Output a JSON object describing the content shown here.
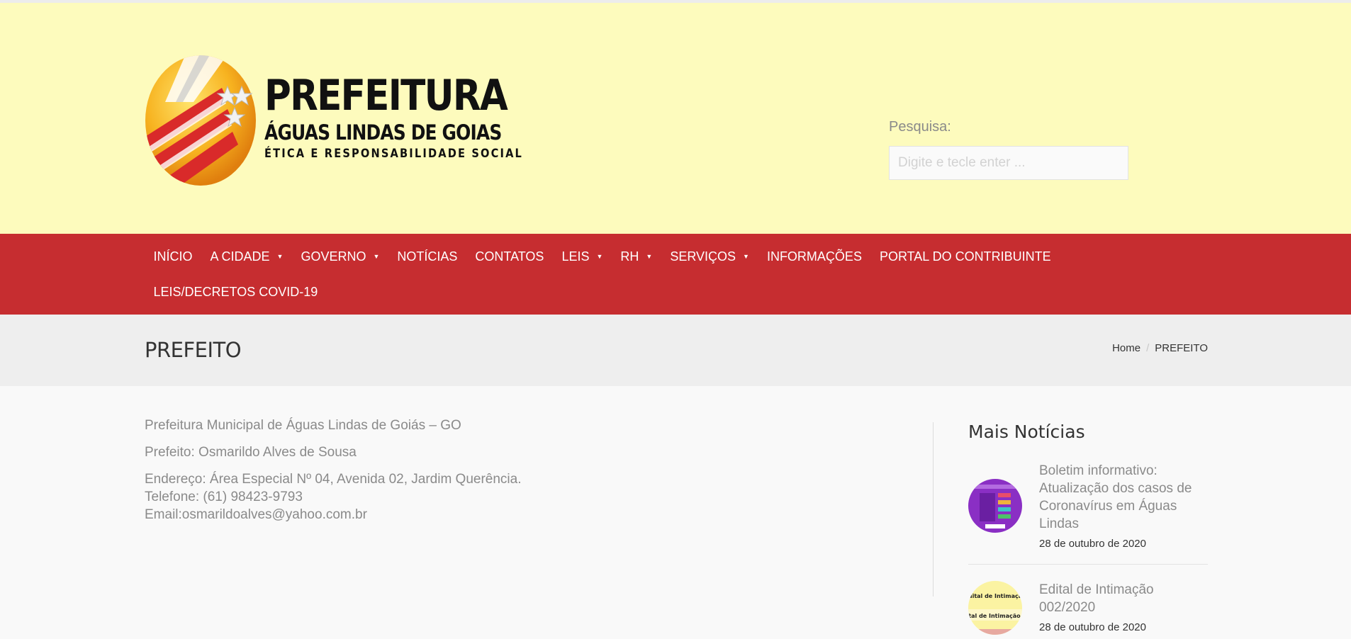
{
  "header": {
    "logo": {
      "line1": "PREFEITURA",
      "line2": "ÁGUAS LINDAS DE GOIAS",
      "line3": "ÉTICA E RESPONSABILIDADE SOCIAL"
    },
    "search": {
      "label": "Pesquisa:",
      "placeholder": "Digite e tecle enter ..."
    }
  },
  "nav": {
    "row1": [
      {
        "label": "INÍCIO",
        "dropdown": false
      },
      {
        "label": "A CIDADE",
        "dropdown": true
      },
      {
        "label": "GOVERNO",
        "dropdown": true
      },
      {
        "label": "NOTÍCIAS",
        "dropdown": false
      },
      {
        "label": "CONTATOS",
        "dropdown": false
      },
      {
        "label": "LEIS",
        "dropdown": true
      },
      {
        "label": "RH",
        "dropdown": true
      },
      {
        "label": "SERVIÇOS",
        "dropdown": true
      },
      {
        "label": "INFORMAÇÕES",
        "dropdown": false
      },
      {
        "label": "PORTAL DO CONTRIBUINTE",
        "dropdown": false
      }
    ],
    "row2": [
      {
        "label": "LEIS/DECRETOS COVID-19",
        "dropdown": false
      }
    ],
    "caret": "▼"
  },
  "title_band": {
    "title": "PREFEITO",
    "breadcrumb": {
      "home": "Home",
      "separator": "/",
      "current": "PREFEITO"
    }
  },
  "content": {
    "para1": "Prefeitura Municipal de Águas Lindas de Goiás – GO",
    "para2": "Prefeito: Osmarildo Alves de Sousa",
    "address": "Endereço: Área Especial Nº 04, Avenida 02, Jardim Querência.",
    "phone": "Telefone: (61) 98423-9793",
    "email": "Email:osmarildoalves@yahoo.com.br"
  },
  "sidebar": {
    "title": "Mais Notícias",
    "news": [
      {
        "title": "Boletim informativo: Atualização dos casos de Coronavírus em Águas Lindas",
        "date": "28 de outubro de 2020"
      },
      {
        "title": "Edital de Intimação 002/2020",
        "date": "28 de outubro de 2020",
        "thumb_text": "Edital de Intimação"
      }
    ]
  },
  "colors": {
    "header_bg": "#fdfbbd",
    "nav_bg": "#c62d30",
    "title_band_bg": "#eeeeee",
    "body_bg": "#f9f9f9"
  }
}
